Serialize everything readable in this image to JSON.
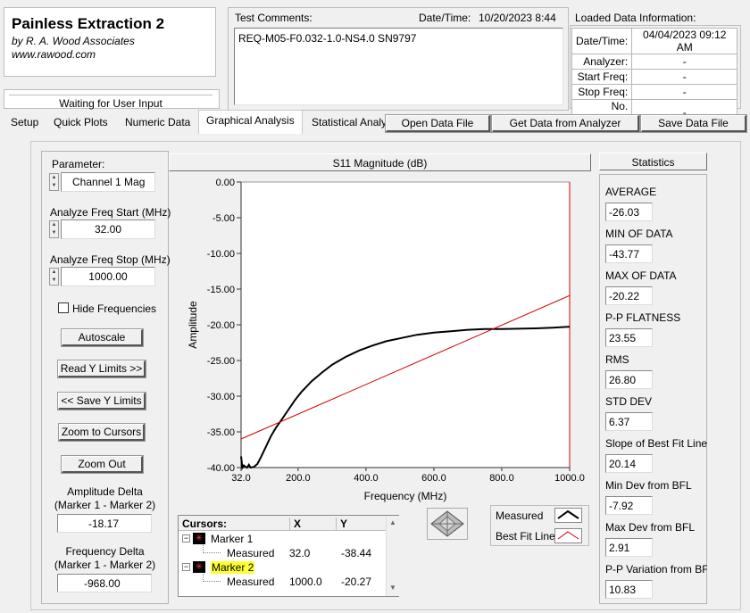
{
  "app": {
    "title": "Painless Extraction 2",
    "author": "by R. A. Wood Associates",
    "website": "www.rawood.com",
    "status": "Waiting for User Input"
  },
  "test": {
    "comments_label": "Test Comments:",
    "datetime_label": "Date/Time:",
    "datetime_value": "10/20/2023  8:44",
    "comments_value": "REQ-M05-F0.032-1.0-NS4.0   SN9797"
  },
  "loaded": {
    "title": "Loaded Data Information:",
    "rows": [
      {
        "label": "Date/Time:",
        "value": "04/04/2023 09:12 AM"
      },
      {
        "label": "Analyzer:",
        "value": "-"
      },
      {
        "label": "Start Freq:",
        "value": "-"
      },
      {
        "label": "Stop Freq:",
        "value": "-"
      },
      {
        "label": "No. Points:",
        "value": "-"
      }
    ]
  },
  "tabs": [
    "Setup",
    "Quick Plots",
    "Numeric Data",
    "Graphical Analysis",
    "Statistical Analy"
  ],
  "file_buttons": {
    "open": "Open Data File",
    "get": "Get Data from Analyzer",
    "save": "Save Data File"
  },
  "controls": {
    "parameter_label": "Parameter:",
    "parameter_value": "Channel 1 Mag",
    "start_label": "Analyze Freq Start (MHz)",
    "start_value": "32.00",
    "stop_label": "Analyze Freq Stop (MHz)",
    "stop_value": "1000.00",
    "hide_freq": "Hide Frequencies",
    "autoscale": "Autoscale",
    "read_y": "Read Y Limits >>",
    "save_y": "<< Save Y Limits",
    "zoom_cursors": "Zoom to Cursors",
    "zoom_out": "Zoom Out",
    "amp_delta_label1": "Amplitude Delta",
    "amp_delta_label2": "(Marker 1 - Marker 2)",
    "amp_delta_value": "-18.17",
    "freq_delta_label1": "Frequency Delta",
    "freq_delta_label2": "(Marker 1 - Marker 2)",
    "freq_delta_value": "-968.00"
  },
  "chart_data": {
    "type": "line",
    "title": "S11 Magnitude (dB)",
    "xlabel": "Frequency (MHz)",
    "ylabel": "Amplitude",
    "xlim": [
      32,
      1000
    ],
    "ylim": [
      -40,
      0
    ],
    "x_ticks": [
      "32.0",
      "200.0",
      "400.0",
      "600.0",
      "800.0",
      "1000.0"
    ],
    "x_tick_values": [
      32,
      200,
      400,
      600,
      800,
      1000
    ],
    "y_ticks": [
      "0.00",
      "-5.00",
      "-10.00",
      "-15.00",
      "-20.00",
      "-25.00",
      "-30.00",
      "-35.00",
      "-40.00"
    ],
    "y_tick_values": [
      0,
      -5,
      -10,
      -15,
      -20,
      -25,
      -30,
      -35,
      -40
    ],
    "series": [
      {
        "name": "Measured",
        "color": "#000000",
        "x": [
          32,
          36,
          40,
          45,
          50,
          55,
          60,
          70,
          80,
          90,
          100,
          110,
          120,
          135,
          150,
          170,
          190,
          210,
          240,
          270,
          300,
          340,
          380,
          420,
          460,
          500,
          550,
          600,
          650,
          700,
          750,
          800,
          850,
          900,
          950,
          1000
        ],
        "y": [
          -38.44,
          -40.0,
          -39.7,
          -39.9,
          -40.0,
          -39.6,
          -40.0,
          -39.9,
          -39.5,
          -38.6,
          -37.6,
          -36.6,
          -35.6,
          -34.4,
          -33.4,
          -32.0,
          -30.6,
          -29.4,
          -27.9,
          -26.7,
          -25.6,
          -24.5,
          -23.6,
          -22.9,
          -22.3,
          -21.9,
          -21.4,
          -21.1,
          -20.9,
          -20.7,
          -20.6,
          -20.6,
          -20.55,
          -20.5,
          -20.4,
          -20.27
        ]
      },
      {
        "name": "Best Fit Line",
        "color": "#d00000",
        "x": [
          32,
          1000
        ],
        "y": [
          -36.0,
          -15.9
        ]
      }
    ],
    "legend": "bottom-right"
  },
  "cursors": {
    "header": [
      "Cursors:",
      "X",
      "Y"
    ],
    "rows": [
      {
        "name": "Marker 1",
        "sub": "Measured",
        "x": "32.0",
        "y": "-38.44"
      },
      {
        "name": "Marker 2",
        "sub": "Measured",
        "x": "1000.0",
        "y": "-20.27"
      }
    ]
  },
  "statistics": {
    "title": "Statistics",
    "items": [
      {
        "label": "AVERAGE",
        "value": "-26.03"
      },
      {
        "label": "MIN OF DATA",
        "value": "-43.77"
      },
      {
        "label": "MAX OF DATA",
        "value": "-20.22"
      },
      {
        "label": "P-P FLATNESS",
        "value": "23.55"
      },
      {
        "label": "RMS",
        "value": "26.80"
      },
      {
        "label": "STD DEV",
        "value": "6.37"
      },
      {
        "label": "Slope of Best Fit Line",
        "value": "20.14"
      },
      {
        "label": "Min Dev from BFL",
        "value": "-7.92"
      },
      {
        "label": "Max Dev from BFL",
        "value": "2.91"
      },
      {
        "label": "P-P Variation from BF",
        "value": "10.83"
      }
    ]
  }
}
